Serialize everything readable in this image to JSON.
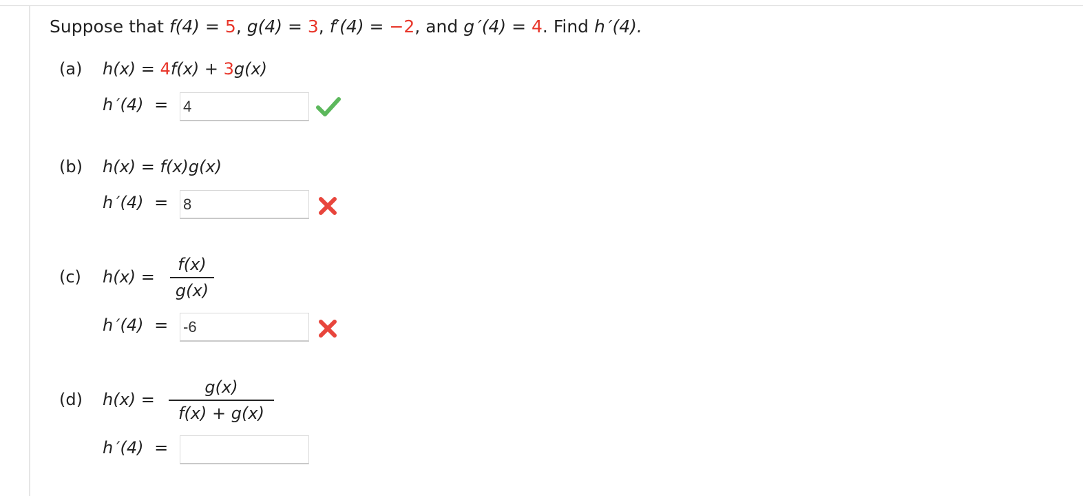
{
  "problem": {
    "prefix": "Suppose that ",
    "f_at_4_lhs": "f(4)",
    "f_at_4_value": "5",
    "g_at_4_lhs": "g(4)",
    "g_at_4_value": "3",
    "fprime_at_4_lhs": "f′(4)",
    "fprime_at_4_value": "−2",
    "and_text": "and",
    "gprime_at_4_lhs": "g ′(4)",
    "gprime_at_4_value": "4",
    "find_text": ". Find ",
    "target": "h ′(4).",
    "equals": "=",
    "comma": ","
  },
  "parts": [
    {
      "label": "(a)",
      "lhs": "h(x)",
      "eq": "=",
      "coef1": "4",
      "term1": "f(x)",
      "plus": "+",
      "coef2": "3",
      "term2": "g(x)",
      "answer_label": "h ′(4)",
      "answer_eq": "=",
      "answer_value": "4",
      "status": "correct"
    },
    {
      "label": "(b)",
      "lhs": "h(x)",
      "eq": "=",
      "expr": "f(x)g(x)",
      "answer_label": "h ′(4)",
      "answer_eq": "=",
      "answer_value": "8",
      "status": "incorrect"
    },
    {
      "label": "(c)",
      "lhs": "h(x)",
      "eq": "=",
      "numerator": "f(x)",
      "denominator": "g(x)",
      "answer_label": "h ′(4)",
      "answer_eq": "=",
      "answer_value": "-6",
      "status": "incorrect"
    },
    {
      "label": "(d)",
      "lhs": "h(x)",
      "eq": "=",
      "numerator": "g(x)",
      "denominator": "f(x) + g(x)",
      "answer_label": "h ′(4)",
      "answer_eq": "=",
      "answer_value": "",
      "status": "unanswered"
    }
  ],
  "icons": {
    "correct": "check-icon",
    "incorrect": "x-mark-icon"
  },
  "colors": {
    "given_value": "#e8362a",
    "check": "#5cb85c",
    "x_mark": "#e8453c"
  }
}
